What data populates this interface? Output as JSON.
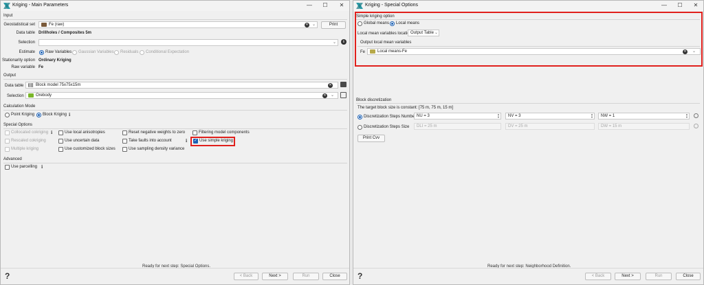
{
  "main": {
    "title": "Kriging - Main Parameters",
    "input_section": "Input",
    "geostat_label": "Geostatistical set",
    "geostat_value": "Fe (raw)",
    "print_label": "Print",
    "datatable_label": "Data table",
    "datatable_value": "Drillholes / Composites 5m",
    "selection_label": "Selection",
    "estimate_label": "Estimate",
    "estimate_options": [
      "Raw Variables",
      "Gaussian Variables",
      "Residuals",
      "Conditional Expectation"
    ],
    "stationarity_label": "Stationarity option",
    "stationarity_value": "Ordinary Kriging",
    "rawvar_label": "Raw variable",
    "rawvar_value": "Fe",
    "output_section": "Output",
    "out_datatable_label": "Data table",
    "out_datatable_value": "Block model 75x75x15m",
    "out_selection_label": "Selection",
    "out_selection_value": "Orebody",
    "calc_section": "Calculation Mode",
    "point_kriging": "Point Kriging",
    "block_kriging": "Block Kriging",
    "special_section": "Special Options",
    "col1": [
      "Collocated cokriging",
      "Rescaled cokriging",
      "Multiple kriging"
    ],
    "col2": [
      "Use local anisotropies",
      "Use uncertain data",
      "Use customized block sizes"
    ],
    "col3": [
      "Reset negative weights to zero",
      "Take faults into account",
      "Use sampling density variance"
    ],
    "col4": [
      "Filtering model components",
      "Use simple kriging"
    ],
    "advanced_section": "Advanced",
    "parcelling": "Use parcelling",
    "status": "Ready for next step: Special Options.",
    "help": "?",
    "back": "< Back",
    "next": "Next >",
    "run": "Run",
    "close": "Close"
  },
  "special": {
    "title": "Kriging - Special Options",
    "simple_section": "Simple kriging option",
    "global_means": "Global means",
    "local_means": "Local means",
    "location_label": "Local mean variables location",
    "location_value": "Output Table",
    "output_vars_label": "Output local mean variables",
    "fe_label": "Fe",
    "fe_value": "Local means-Fe",
    "block_section": "Block discretization",
    "block_size_text": "The target block size is constant: [75 m, 75 m, 15 m]",
    "steps_number": "Discretization Steps Number",
    "steps_size": "Discretization Steps Size",
    "nu": "NU = 3",
    "nv": "NV = 3",
    "nw": "NW = 1",
    "dli": "DLI = 25 m",
    "dv": "DV = 25 m",
    "dw": "DW = 15 m",
    "print_cvv": "Print Cvv",
    "status": "Ready for next step: Neighborhood Definition.",
    "help": "?",
    "back": "< Back",
    "next": "Next >",
    "run": "Run",
    "close": "Close"
  },
  "colors": {
    "accent": "#1a5fb4",
    "highlight": "#e0201c",
    "brand": "#2a9aa6"
  },
  "window_controls": [
    "—",
    "☐",
    "✕"
  ]
}
